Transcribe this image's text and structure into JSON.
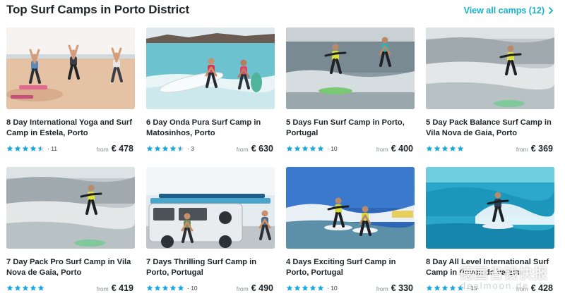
{
  "header": {
    "title": "Top Surf Camps in Porto District",
    "view_all_label": "View all camps (12)",
    "view_all_icon": "chevron-right-icon"
  },
  "colors": {
    "accent": "#16b3c8",
    "star": "#1aa7dc",
    "text": "#222629",
    "muted": "#8a9096"
  },
  "cards": [
    {
      "title": "8 Day International Yoga and Surf Camp in Estela, Porto",
      "rating": 4.5,
      "reviews": "· 11",
      "from": "from",
      "price": "€ 478",
      "scene": "beach-yoga"
    },
    {
      "title": "6 Day Onda Pura Surf Camp in Matosinhos, Porto",
      "rating": 4.5,
      "reviews": "· 3",
      "from": "from",
      "price": "€ 630",
      "scene": "surfboard-shore"
    },
    {
      "title": "5 Days Fun Surf Camp in Porto, Portugal",
      "rating": 5,
      "reviews": "· 10",
      "from": "from",
      "price": "€ 400",
      "scene": "surf-lesson"
    },
    {
      "title": "5 Day Pack Balance Surf Camp in Vila Nova de Gaia, Porto",
      "rating": 5,
      "reviews": "",
      "from": "from",
      "price": "€ 369",
      "scene": "surfer-wave"
    },
    {
      "title": "7 Day Pack Pro Surf Camp in Vila Nova de Gaia, Porto",
      "rating": 5,
      "reviews": "",
      "from": "from",
      "price": "€ 419",
      "scene": "surfer-wave"
    },
    {
      "title": "7 Days Thrilling Surf Camp in Porto, Portugal",
      "rating": 5,
      "reviews": "· 10",
      "from": "from",
      "price": "€ 490",
      "scene": "surf-van"
    },
    {
      "title": "4 Days Exciting Surf Camp in Porto, Portugal",
      "rating": 5,
      "reviews": "· 10",
      "from": "from",
      "price": "€ 330",
      "scene": "two-surfers"
    },
    {
      "title": "8 Day All Level International Surf Camp in Póvoa de Varzim",
      "rating": 5,
      "reviews": "· 15",
      "from": "from",
      "price": "€ 428",
      "scene": "surfer-blue-wave"
    }
  ],
  "watermark": {
    "main": "德国省钱快报",
    "sub": "dealmoon.de"
  }
}
